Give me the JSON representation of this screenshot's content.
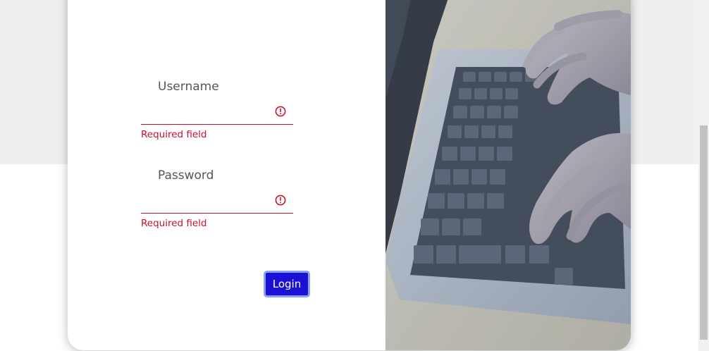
{
  "login_form": {
    "username": {
      "label": "Username",
      "value": "",
      "error": "Required field"
    },
    "password": {
      "label": "Password",
      "value": "",
      "error": "Required field"
    },
    "submit_label": "Login"
  },
  "colors": {
    "accent": "#1a10d6",
    "error": "#c8102e",
    "background_top": "#efefef"
  },
  "photo": {
    "subject": "hands typing on a laptop keyboard"
  }
}
